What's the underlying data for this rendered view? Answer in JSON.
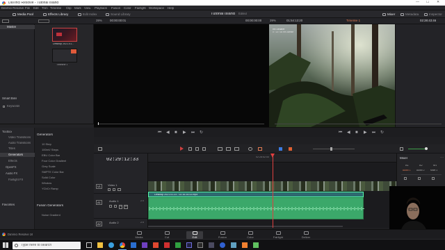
{
  "window": {
    "title": "DaVinci Resolve - Tutorial Island",
    "controls": [
      "—",
      "☐",
      "✕"
    ]
  },
  "menu": [
    "DaVinci Resolve",
    "File",
    "Edit",
    "Trim",
    "Timeline",
    "Clip",
    "Mark",
    "View",
    "Playback",
    "Fusion",
    "Color",
    "Fairlight",
    "Workspace",
    "Help"
  ],
  "toolbar": {
    "media_pool": "Media Pool",
    "effects_library": "Effects Library",
    "edit_index": "Edit Index",
    "sound_library": "Sound Library",
    "project_title": "Tutorial Island",
    "project_status": "Edited",
    "mixer": "Mixer",
    "metadata": "Metadata",
    "inspector": "Inspector"
  },
  "viewer_header": {
    "src_zoom": "39%",
    "src_timecode": "00:00:00:01",
    "src_duration": "00:00:00:00",
    "prg_zoom": "39%",
    "prg_duration": "01:54:13:20",
    "timeline_name": "Timeline 1",
    "prg_timecode": "02:28:43:46"
  },
  "left_panel": {
    "master": "Master",
    "smart_bins": "Smart Bins",
    "keywords": "Keywords"
  },
  "media_pool": {
    "clips": [
      {
        "label": "Desktop 2021.01..."
      },
      {
        "label": "Timeline 1"
      }
    ]
  },
  "program_overlay": {
    "line1": "Re-Sedarer",
    "line2": "0 : 13 / 16 Re-Samse"
  },
  "effects": {
    "categories": [
      {
        "label": "Toolbox",
        "selected": false,
        "indent": false
      },
      {
        "label": "Video Transitions",
        "selected": false,
        "indent": true
      },
      {
        "label": "Audio Transitions",
        "selected": false,
        "indent": true
      },
      {
        "label": "Titles",
        "selected": false,
        "indent": true
      },
      {
        "label": "Generators",
        "selected": true,
        "indent": true
      },
      {
        "label": "Effects",
        "selected": false,
        "indent": true
      },
      {
        "label": "OpenFX",
        "selected": false,
        "indent": false
      },
      {
        "label": "Audio FX",
        "selected": false,
        "indent": false
      },
      {
        "label": "Fairlight FX",
        "selected": false,
        "indent": true
      }
    ],
    "favorites": "Favorites",
    "generators_header": "Generators",
    "generators": [
      "10 Step",
      "100mV Steps",
      "EBU Color Bar",
      "Four Color Gradient",
      "Grey Scale",
      "SMPTE Color Bar",
      "Solid Color",
      "Window",
      "YCbCr Ramp"
    ],
    "fusion_header": "Fusion Generators",
    "fusion_items": [
      "Noise Gradient"
    ]
  },
  "timeline": {
    "timecode": "02:29:12:33",
    "ruler_label": "02:28:52:00",
    "tracks": [
      {
        "id": "V1",
        "name": "Video 1",
        "clip": ""
      },
      {
        "id": "A1",
        "name": "Audio 1",
        "level": "2.0",
        "clip": "Desktop 2021.01.23 - 02.16.34.02.mp4"
      },
      {
        "id": "A2",
        "name": "Audio 2",
        "level": "2.0",
        "clip": ""
      }
    ],
    "playhead_fraction": 0.5
  },
  "mixer": {
    "title": "Mixer",
    "channels": [
      "A1",
      "A2",
      "M1"
    ],
    "inputs": [
      "Audio 1",
      "Audio 2",
      "Main 1"
    ]
  },
  "pages": [
    {
      "label": "Media",
      "active": false
    },
    {
      "label": "Cut",
      "active": false
    },
    {
      "label": "Edit",
      "active": true
    },
    {
      "label": "Fusion",
      "active": false
    },
    {
      "label": "Color",
      "active": false
    },
    {
      "label": "Fairlight",
      "active": false
    },
    {
      "label": "Deliver",
      "active": false
    }
  ],
  "app_footer": "DaVinci Resolve 16",
  "taskbar": {
    "search_placeholder": "Type here to search"
  }
}
